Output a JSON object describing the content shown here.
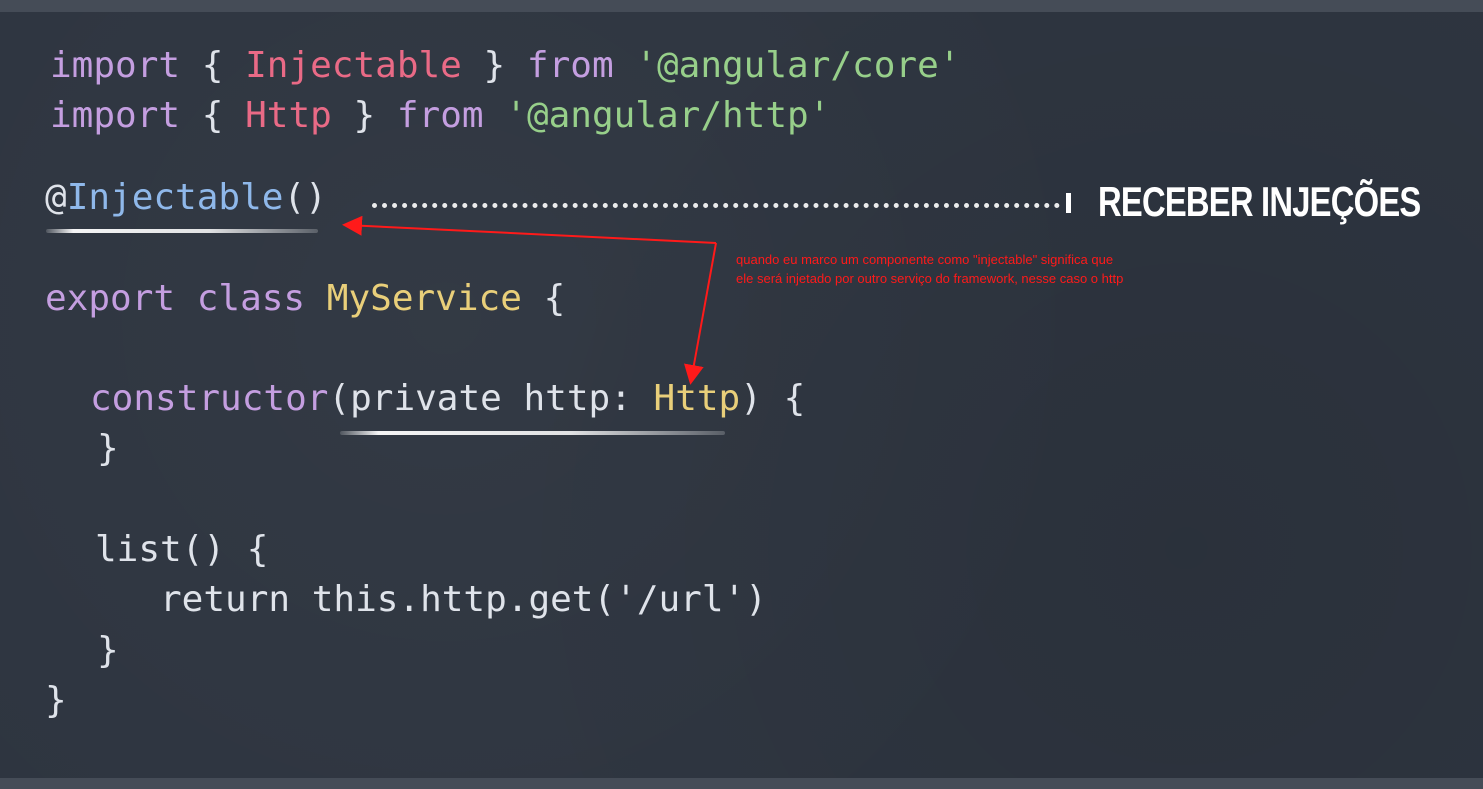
{
  "code": {
    "line1": {
      "kw1": "import",
      "brace_open": "{",
      "cls": "Injectable",
      "brace_close": "}",
      "kw2": "from",
      "str": "'@angular/core'"
    },
    "line2": {
      "kw1": "import",
      "brace_open": "{",
      "cls": "Http",
      "brace_close": "}",
      "kw2": "from",
      "str": "'@angular/http'"
    },
    "line3": {
      "at": "@",
      "dec": "Injectable",
      "parens": "()"
    },
    "line4": {
      "kw1": "export",
      "kw2": "class",
      "cls": "MyService",
      "brace": "{"
    },
    "line5": {
      "fn": "constructor",
      "args": "(private http: ",
      "typ": "Http",
      "rest": ") {"
    },
    "line6": {
      "text": "}"
    },
    "line7": {
      "text": "list() {"
    },
    "line8": {
      "text": "return this.http.get('/url')"
    },
    "line9": {
      "text": "}"
    },
    "line10": {
      "text": "}"
    }
  },
  "label": {
    "title": "RECEBER INJEÇÕES"
  },
  "annotation": {
    "line1": "quando eu marco um componente como \"injectable\" significa que",
    "line2": "ele será injetado por outro serviço do framework, nesse caso o http",
    "color": "#ff1a1a"
  },
  "colors": {
    "background": "#2e3540",
    "keyword": "#c49ee0",
    "class_name": "#e96a86",
    "string": "#97cf8a",
    "decorator": "#8fb8ea",
    "type": "#e9cf7a",
    "plain": "#dfe3ea"
  }
}
